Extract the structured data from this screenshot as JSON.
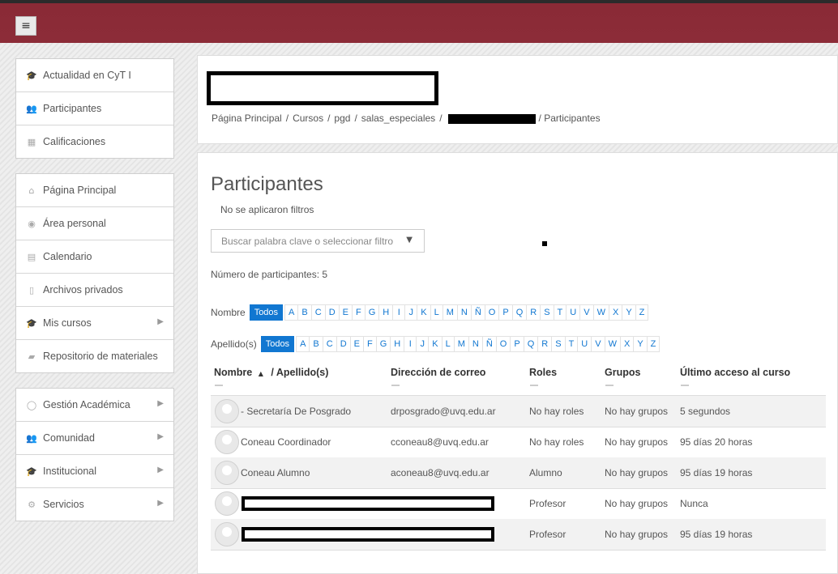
{
  "topbar": {
    "menu_icon": "hamburger-icon",
    "menu_glyph": "≡"
  },
  "sidebar": {
    "block1": [
      {
        "label": "Actualidad en CyT I",
        "icon": "mortarboard-icon",
        "glyph": "🎓"
      },
      {
        "label": "Participantes",
        "icon": "users-icon",
        "glyph": "👥"
      },
      {
        "label": "Calificaciones",
        "icon": "table-icon",
        "glyph": "▦"
      }
    ],
    "block2": [
      {
        "label": "Página Principal",
        "icon": "home-icon",
        "glyph": "⌂"
      },
      {
        "label": "Área personal",
        "icon": "dashboard-icon",
        "glyph": "◉"
      },
      {
        "label": "Calendario",
        "icon": "calendar-icon",
        "glyph": "▤"
      },
      {
        "label": "Archivos privados",
        "icon": "file-icon",
        "glyph": "▯"
      },
      {
        "label": "Mis cursos",
        "icon": "mortarboard-icon",
        "glyph": "🎓",
        "chevron": "▶"
      },
      {
        "label": "Repositorio de materiales",
        "icon": "book-icon",
        "glyph": "▰"
      }
    ],
    "block3": [
      {
        "label": "Gestión Académica",
        "icon": "user-circle-icon",
        "glyph": "◯",
        "chevron": "▶"
      },
      {
        "label": "Comunidad",
        "icon": "users-icon",
        "glyph": "👥",
        "chevron": "▶"
      },
      {
        "label": "Institucional",
        "icon": "mortarboard-icon",
        "glyph": "🎓",
        "chevron": "▶"
      },
      {
        "label": "Servicios",
        "icon": "gear-icon",
        "glyph": "⚙",
        "chevron": "▶"
      }
    ]
  },
  "breadcrumb": {
    "items": [
      "Página Principal",
      "/",
      "Cursos",
      "/",
      "pgd",
      "/",
      "salas_especiales",
      "/"
    ],
    "last": "/  Participantes"
  },
  "page": {
    "title": "Participantes",
    "no_filters": "No se aplicaron filtros",
    "search_placeholder": "Buscar palabra clave o seleccionar filtro",
    "search_arrow": "▼",
    "count": "Número de participantes: 5"
  },
  "filters": {
    "first_label": "Nombre",
    "last_label": "Apellido(s)",
    "all": "Todos",
    "letters": [
      "A",
      "B",
      "C",
      "D",
      "E",
      "F",
      "G",
      "H",
      "I",
      "J",
      "K",
      "L",
      "M",
      "N",
      "Ñ",
      "O",
      "P",
      "Q",
      "R",
      "S",
      "T",
      "U",
      "V",
      "W",
      "X",
      "Y",
      "Z"
    ]
  },
  "table": {
    "headers": {
      "name": "Nombre",
      "sort_icon": "▲",
      "surname": "/ Apellido(s)",
      "email": "Dirección de correo",
      "roles": "Roles",
      "groups": "Grupos",
      "last_access": "Último acceso al curso"
    },
    "rows": [
      {
        "name": "- Secretaría De Posgrado",
        "email": "drposgrado@uvq.edu.ar",
        "roles": "No hay roles",
        "groups": "No hay grupos",
        "access": "5 segundos",
        "redacted": false
      },
      {
        "name": "Coneau Coordinador",
        "email": "cconeau8@uvq.edu.ar",
        "roles": "No hay roles",
        "groups": "No hay grupos",
        "access": "95 días 20 horas",
        "redacted": false
      },
      {
        "name": "Coneau Alumno",
        "email": "aconeau8@uvq.edu.ar",
        "roles": "Alumno",
        "groups": "No hay grupos",
        "access": "95 días 19 horas",
        "redacted": false
      },
      {
        "name": "",
        "email": "",
        "roles": "Profesor",
        "groups": "No hay grupos",
        "access": "Nunca",
        "redacted": true
      },
      {
        "name": "",
        "email": "",
        "roles": "Profesor",
        "groups": "No hay grupos",
        "access": "95 días 19 horas",
        "redacted": true
      }
    ]
  }
}
